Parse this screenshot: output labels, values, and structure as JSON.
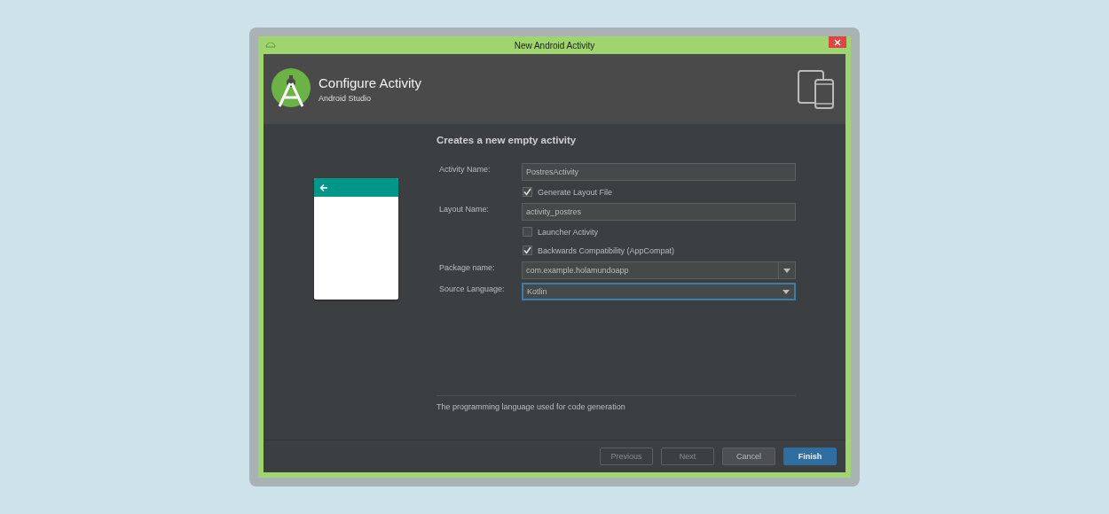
{
  "window": {
    "title": "New Android Activity"
  },
  "header": {
    "title": "Configure Activity",
    "subtitle": "Android Studio"
  },
  "form": {
    "heading": "Creates a new empty activity",
    "rows": [
      {
        "kind": "text",
        "label": "Activity Name:",
        "value": "PostresActivity"
      },
      {
        "kind": "checkbox",
        "label": "Generate Layout File",
        "checked": true
      },
      {
        "kind": "text",
        "label": "Layout Name:",
        "value": "activity_postres"
      },
      {
        "kind": "checkbox",
        "label": "Launcher Activity",
        "checked": false
      },
      {
        "kind": "checkbox",
        "label": "Backwards Compatibility (AppCompat)",
        "checked": true
      },
      {
        "kind": "combo",
        "label": "Package name:",
        "value": "com.example.holamundoapp",
        "focused": false
      },
      {
        "kind": "select",
        "label": "Source Language:",
        "value": "Kotlin",
        "focused": true
      }
    ],
    "description": "The programming language used for code generation"
  },
  "buttons": [
    {
      "label": "Previous",
      "kind": "normal",
      "disabled": true
    },
    {
      "label": "Next",
      "kind": "normal",
      "disabled": true
    },
    {
      "label": "Cancel",
      "kind": "normal",
      "disabled": false
    },
    {
      "label": "Finish",
      "kind": "primary",
      "disabled": false
    }
  ]
}
